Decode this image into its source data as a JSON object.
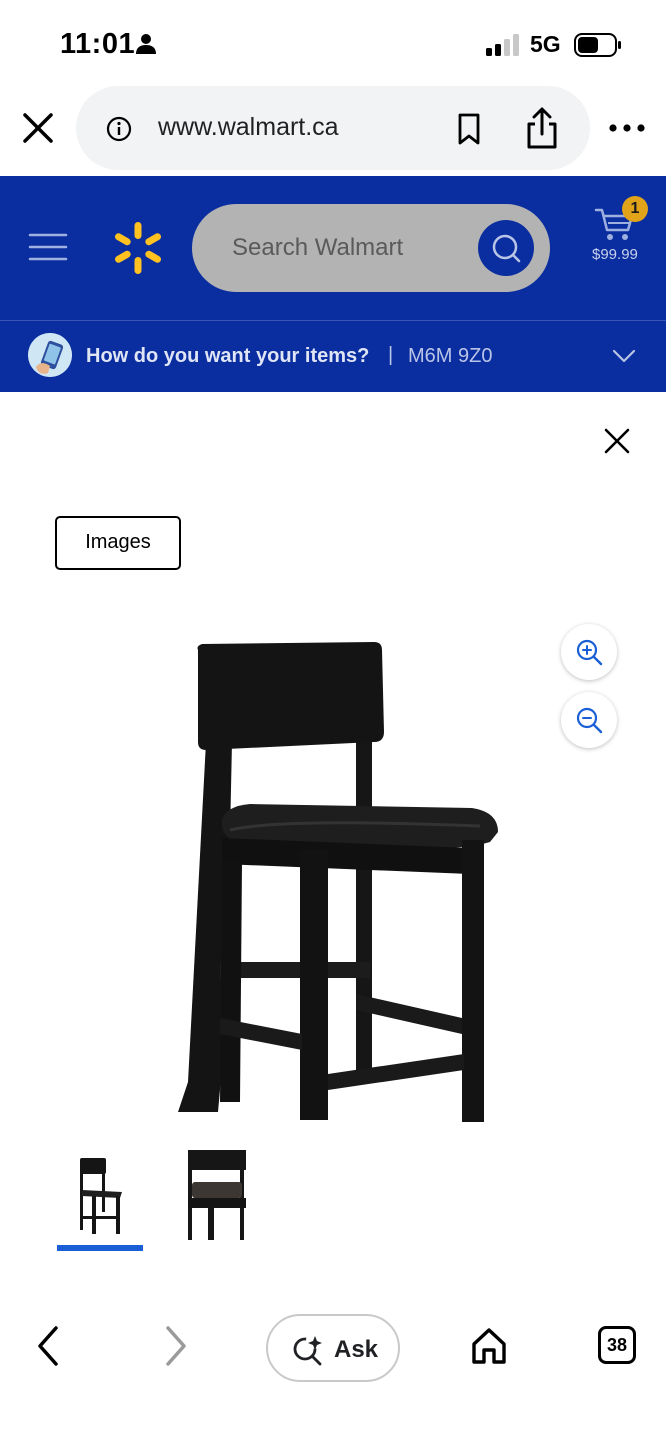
{
  "status_bar": {
    "time": "11:01",
    "network": "5G",
    "icons": [
      "person-icon",
      "signal-icon",
      "battery-icon"
    ]
  },
  "browser": {
    "url": "www.walmart.ca",
    "icons": [
      "close-icon",
      "info-icon",
      "bookmark-icon",
      "share-icon",
      "more-icon"
    ]
  },
  "header": {
    "search_placeholder": "Search Walmart",
    "cart_count": "1",
    "cart_total": "$99.99",
    "colors": {
      "brand_blue": "#0a2ea0",
      "spark_yellow": "#ffc220",
      "badge": "#e0a31a"
    }
  },
  "delivery": {
    "question": "How do you want your items?",
    "separator": "|",
    "postal_code": "M6M 9Z0"
  },
  "modal": {
    "tab_label": "Images",
    "thumbnails": [
      "chair-front-thumbnail",
      "chair-seat-thumbnail"
    ],
    "selected_thumbnail": 0,
    "indicator_color": "#1a5fd6"
  },
  "toolbar": {
    "ask_label": "Ask",
    "tab_count": "38"
  }
}
